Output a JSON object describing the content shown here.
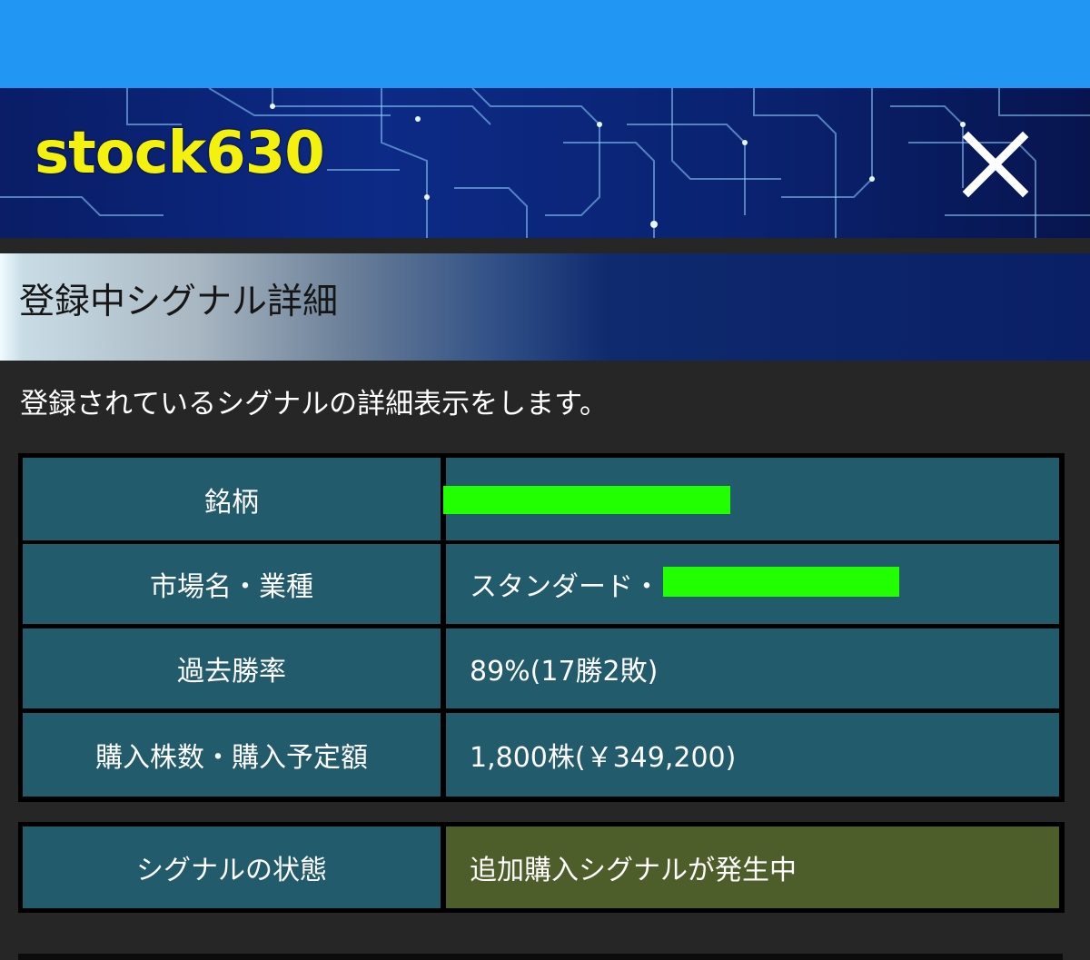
{
  "app": {
    "title": "stock630"
  },
  "section": {
    "title": "登録中シグナル詳細"
  },
  "description": "登録されているシグナルの詳細表示をします。",
  "details": {
    "rows": [
      {
        "label": "銘柄",
        "value": ""
      },
      {
        "label": "市場名・業種",
        "value": "スタンダード・"
      },
      {
        "label": "過去勝率",
        "value": "89%(17勝2敗)"
      },
      {
        "label": "購入株数・購入予定額",
        "value": "1,800株(￥349,200)"
      }
    ]
  },
  "status": {
    "label": "シグナルの状態",
    "value": "追加購入シグナルが発生中"
  },
  "icons": {
    "close": "close-icon"
  },
  "colors": {
    "statusbar": "#2196f3",
    "title": "#f5f10f",
    "cell": "#225b6b",
    "status_cell": "#4e5e2a",
    "redaction": "#21ff00"
  }
}
